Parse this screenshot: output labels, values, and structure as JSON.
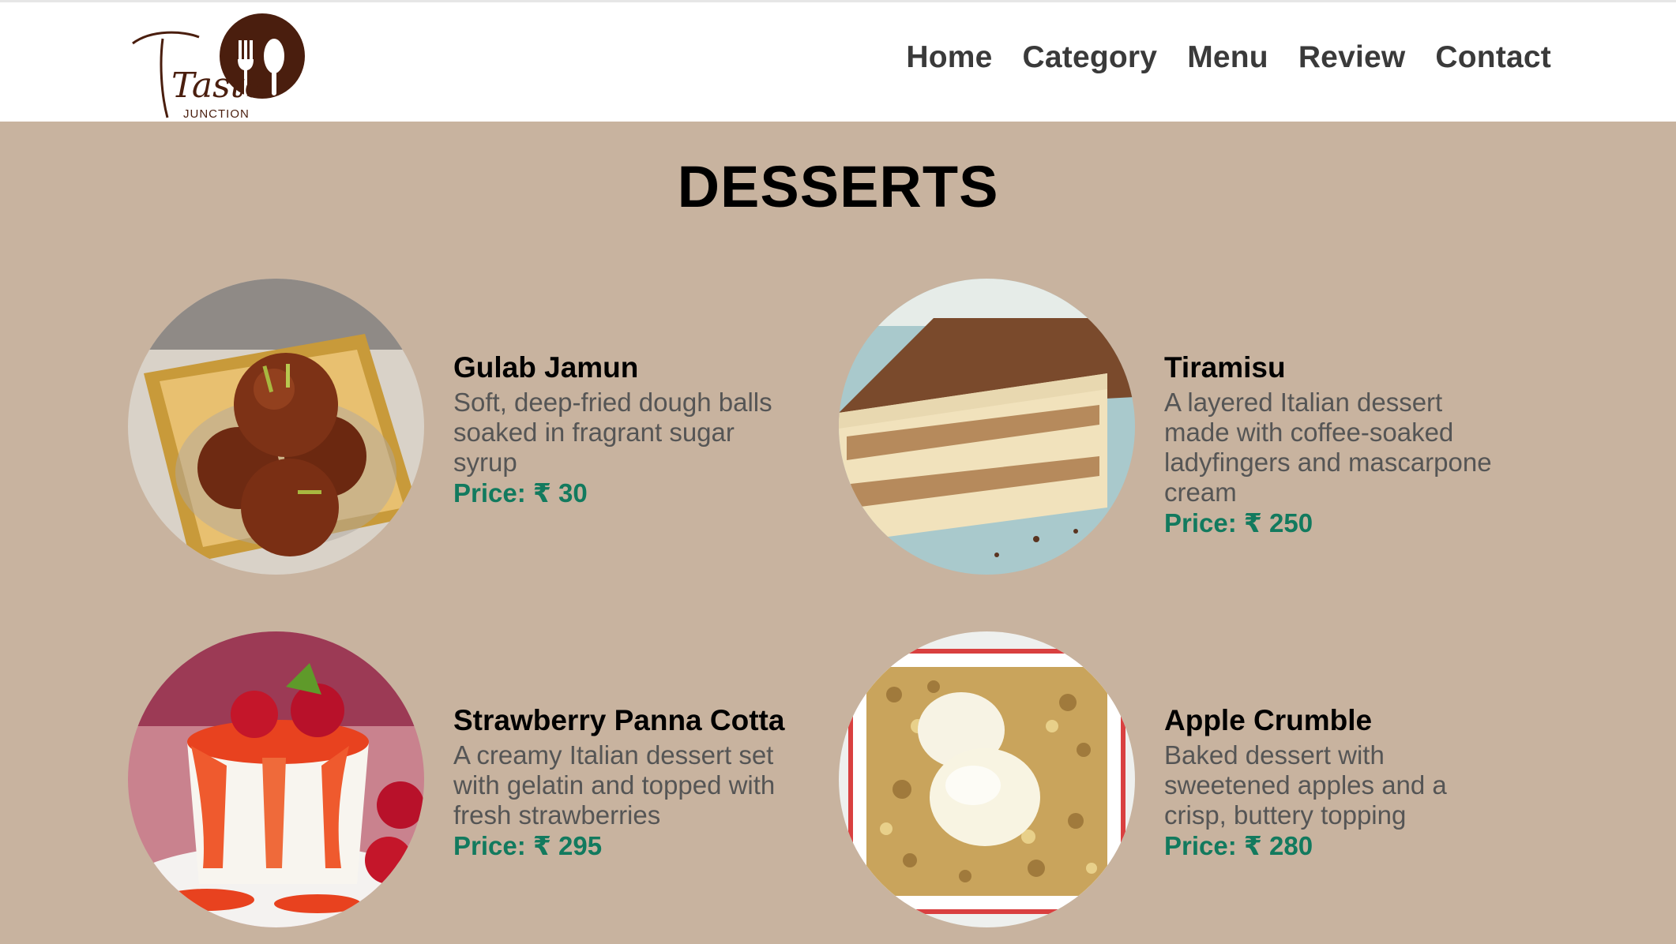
{
  "brand": {
    "logo_text": "Taste",
    "logo_subtext": "Junction"
  },
  "nav": {
    "items": [
      {
        "label": "Home"
      },
      {
        "label": "Category"
      },
      {
        "label": "Menu"
      },
      {
        "label": "Review"
      },
      {
        "label": "Contact"
      }
    ]
  },
  "section": {
    "title": "DESSERTS"
  },
  "dishes": [
    {
      "name": "Gulab Jamun",
      "description": "Soft, deep-fried dough balls soaked in fragrant sugar syrup",
      "price": "Price: ₹ 30",
      "image_icon": "gulab-jamun-photo"
    },
    {
      "name": "Tiramisu",
      "description": "A layered Italian dessert made with coffee-soaked ladyfingers and mascarpone cream",
      "price": "Price: ₹ 250",
      "image_icon": "tiramisu-photo"
    },
    {
      "name": "Strawberry Panna Cotta",
      "description": "A creamy Italian dessert set with gelatin and topped with fresh strawberries",
      "price": "Price: ₹ 295",
      "image_icon": "panna-cotta-photo"
    },
    {
      "name": "Apple Crumble",
      "description": "Baked dessert with sweetened apples and a crisp, buttery topping",
      "price": "Price: ₹ 280",
      "image_icon": "apple-crumble-photo"
    }
  ],
  "colors": {
    "background": "#c8b39f",
    "navbar": "#ffffff",
    "price": "#127a5e",
    "logo": "#4a1e0e"
  }
}
